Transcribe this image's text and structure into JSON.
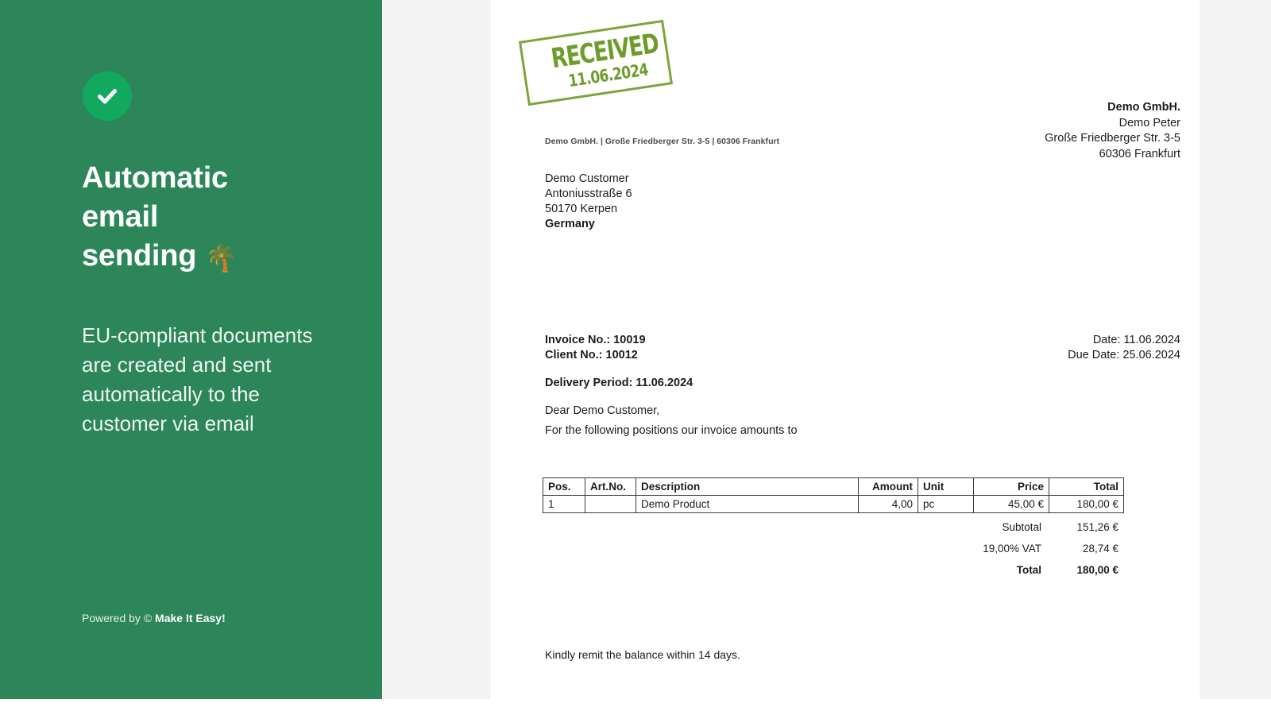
{
  "colors": {
    "panel_green": "#2d8659",
    "badge_green": "#12a85e",
    "stamp_green": "#6e9c2b",
    "backdrop_gray": "#f4f4f4",
    "document_white": "#ffffff"
  },
  "promo": {
    "check_icon": "check-circle-icon",
    "title_line1": "Automatic",
    "title_line2": "email",
    "title_line3": "sending",
    "title_emoji": "🌴",
    "body": "EU-compliant documents are created and sent automatically to the customer via email",
    "footer_prefix": "Powered by © ",
    "footer_brand": "Make It Easy!"
  },
  "invoice": {
    "stamp": {
      "word": "RECEIVED",
      "date": "11.06.2024"
    },
    "sender_line": "Demo GmbH. | Große Friedberger Str. 3-5 | 60306 Frankfurt",
    "recipient": {
      "name": "Demo Customer",
      "street": "Antoniusstraße 6",
      "city": "50170 Kerpen",
      "country": "Germany"
    },
    "company": {
      "name": "Demo GmbH.",
      "contact": "Demo Peter",
      "street": "Große Friedberger Str. 3-5",
      "city": "60306 Frankfurt"
    },
    "meta": {
      "invoice_no_label": "Invoice No.: ",
      "invoice_no": "10019",
      "client_no_label": "Client No.: ",
      "client_no": "10012",
      "delivery_period": "Delivery Period: 11.06.2024",
      "date": "Date: 11.06.2024",
      "due_date": "Due Date: 25.06.2024"
    },
    "salutation": "Dear Demo Customer,",
    "intro": "For the following positions our invoice amounts to",
    "table": {
      "headers": [
        "Pos.",
        "Art.No.",
        "Description",
        "Amount",
        "Unit",
        "Price",
        "Total"
      ],
      "rows": [
        {
          "pos": "1",
          "art_no": "",
          "description": "Demo Product",
          "amount": "4,00",
          "unit": "pc",
          "price": "45,00 €",
          "total": "180,00 €"
        }
      ]
    },
    "totals": [
      {
        "label": "Subtotal",
        "value": "151,26 €",
        "bold": false
      },
      {
        "label": "19,00% VAT",
        "value": "28,74 €",
        "bold": false
      },
      {
        "label": "Total",
        "value": "180,00 €",
        "bold": true
      }
    ],
    "closing_note": "Kindly remit the balance within 14 days."
  }
}
